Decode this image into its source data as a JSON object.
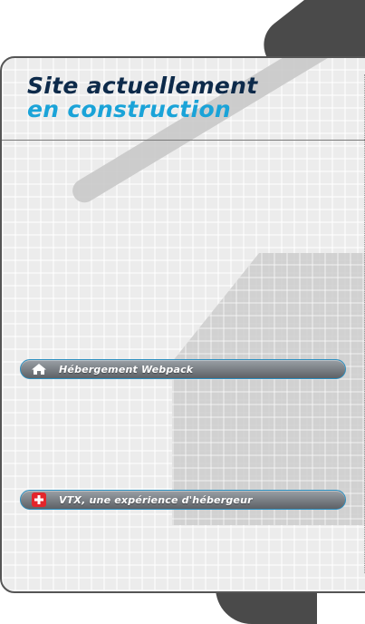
{
  "header": {
    "title_line1": "Site actuellement",
    "title_line2": "en construction"
  },
  "links": [
    {
      "label": "Hébergement Webpack",
      "icon": "house-icon"
    },
    {
      "label": "VTX, une expérience d'hébergeur",
      "icon": "swiss-flag-icon"
    }
  ],
  "colors": {
    "title_dark": "#0d2a4a",
    "title_accent": "#1aa3d8",
    "pill_border": "#2c8fc0",
    "flag_red": "#e3262c"
  }
}
